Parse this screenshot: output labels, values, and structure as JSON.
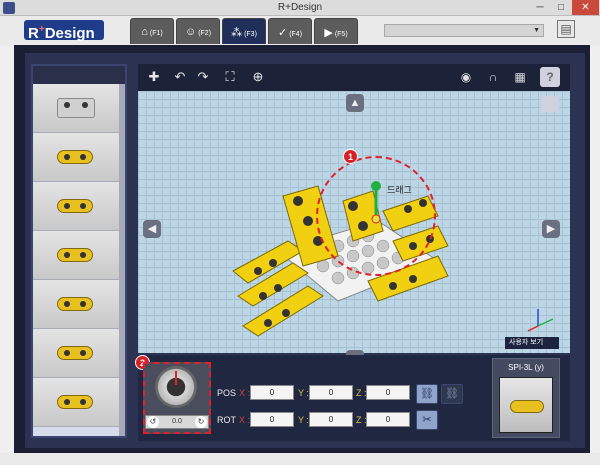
{
  "window": {
    "title": "R+Design",
    "minimize": "─",
    "maximize": "□",
    "close": "✕"
  },
  "brand": {
    "logo_main": "R",
    "logo_sup": "+",
    "logo_rest": "Design"
  },
  "tabs": [
    {
      "icon": "home-icon",
      "glyph": "⌂",
      "label": "(F1)",
      "active": false
    },
    {
      "icon": "user-icon",
      "glyph": "☺",
      "label": "(F2)",
      "active": false
    },
    {
      "icon": "grid-icon",
      "glyph": "⁂",
      "label": "(F3)",
      "active": true
    },
    {
      "icon": "check-icon",
      "glyph": "✓",
      "label": "(F4)",
      "active": false
    },
    {
      "icon": "play-icon",
      "glyph": "▶",
      "label": "(F5)",
      "active": false
    }
  ],
  "toolbar": {
    "tools": [
      {
        "name": "add-part-icon",
        "glyph": "✚"
      },
      {
        "name": "undo-icon",
        "glyph": "↶"
      },
      {
        "name": "redo-icon",
        "glyph": "↷"
      },
      {
        "name": "focus-icon",
        "glyph": "⛶"
      },
      {
        "name": "fit-view-icon",
        "glyph": "⊕"
      }
    ],
    "right_tools": [
      {
        "name": "eye-icon",
        "glyph": "◉"
      },
      {
        "name": "magnet-icon",
        "glyph": "∩"
      },
      {
        "name": "grid-toggle-icon",
        "glyph": "▦"
      },
      {
        "name": "help-icon",
        "glyph": "?"
      }
    ]
  },
  "viewport": {
    "drag_label": "드래그",
    "view_label": "사용자 보기",
    "badge1": "1",
    "badge2": "2",
    "camera_glyph": "📷"
  },
  "rotation": {
    "value": "0.0",
    "ccw": "↺",
    "cw": "↻"
  },
  "position": {
    "pos_label": "POS",
    "rot_label": "ROT",
    "x_label": "X :",
    "y_label": "Y :",
    "z_label": "Z :",
    "pos": {
      "x": "0",
      "y": "0",
      "z": "0"
    },
    "rot": {
      "x": "0",
      "y": "0",
      "z": "0"
    }
  },
  "selected_part": {
    "title": "SPI-3L (y)"
  }
}
